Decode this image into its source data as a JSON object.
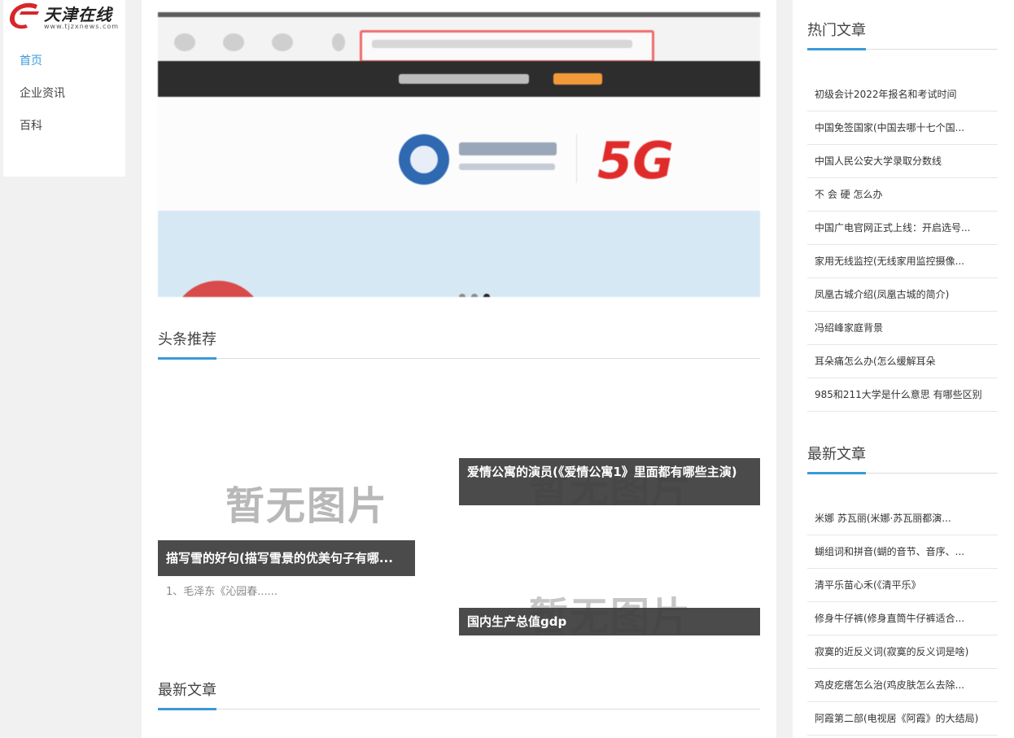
{
  "logo": {
    "text": "天津在线",
    "url": "www.tjzxnews.com"
  },
  "nav": {
    "items": [
      "首页",
      "企业资讯",
      "百科"
    ]
  },
  "main": {
    "headlines_title": "头条推荐",
    "latest_title": "最新文章",
    "placeholder_text": "暂无图片",
    "cards": [
      {
        "title": "描写雪的好句(描写雪景的优美句子有哪...",
        "excerpt": "1、毛泽东《沁园春......"
      },
      {
        "title": "爱情公寓的演员(《爱情公寓1》里面都有哪些主演)"
      },
      {
        "title": "国内生产总值gdp"
      }
    ]
  },
  "sidebar": {
    "hot_title": "热门文章",
    "hot": [
      "初级会计2022年报名和考试时间",
      "中国免签国家(中国去哪十七个国...",
      "中国人民公安大学录取分数线",
      "不 会 硬 怎么办",
      "中国广电官网正式上线：开启选号...",
      "家用无线监控(无线家用监控摄像...",
      "凤凰古城介绍(凤凰古城的简介)",
      "冯绍峰家庭背景",
      "耳朵痛怎么办(怎么缓解耳朵",
      "985和211大学是什么意思 有哪些区别"
    ],
    "latest_title": "最新文章",
    "latest": [
      "米娜 苏瓦丽(米娜·苏瓦丽都演...",
      "蝴组词和拼音(蝴的音节、音序、...",
      "清平乐苗心禾(《清平乐》",
      "修身牛仔裤(修身直筒牛仔裤适合...",
      "寂寞的近反义词(寂寞的反义词是啥)",
      "鸡皮疙瘩怎么治(鸡皮肤怎么去除...",
      "阿霞第二部(电视居《阿霞》的大结局)"
    ]
  }
}
